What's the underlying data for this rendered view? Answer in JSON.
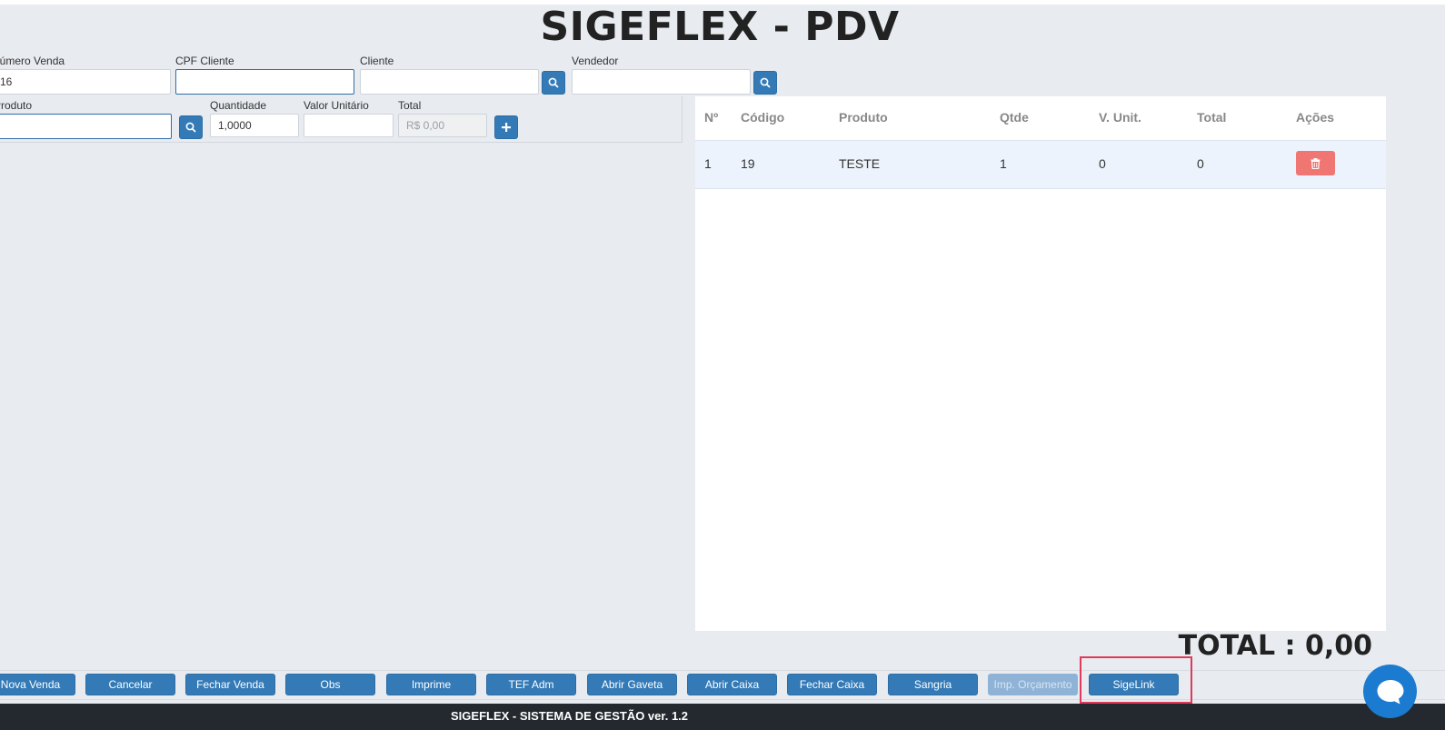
{
  "page_title": "SIGEFLEX - PDV",
  "form": {
    "numero_venda": {
      "label": "Número Venda",
      "value": "16"
    },
    "cpf_cliente": {
      "label": "CPF Cliente",
      "value": ""
    },
    "cliente": {
      "label": "Cliente",
      "value": ""
    },
    "vendedor": {
      "label": "Vendedor",
      "value": ""
    },
    "produto": {
      "label": "Produto",
      "value": ""
    },
    "quantidade": {
      "label": "Quantidade",
      "value": "1,0000"
    },
    "valor_unitario": {
      "label": "Valor Unitário",
      "value": ""
    },
    "total": {
      "label": "Total",
      "placeholder": "R$ 0,00"
    }
  },
  "table": {
    "headers": [
      "Nº",
      "Código",
      "Produto",
      "Qtde",
      "V. Unit.",
      "Total",
      "Ações"
    ],
    "rows": [
      {
        "n": "1",
        "codigo": "19",
        "produto": "TESTE",
        "qtde": "1",
        "v_unit": "0",
        "total": "0"
      }
    ]
  },
  "summary": {
    "total_text": "TOTAL : 0,00"
  },
  "actions": [
    "Nova Venda",
    "Cancelar",
    "Fechar Venda",
    "Obs",
    "Imprime",
    "TEF Adm",
    "Abrir Gaveta",
    "Abrir Caixa",
    "Fechar Caixa",
    "Sangria",
    "Imp. Orçamento",
    "SigeLink"
  ],
  "footer": {
    "text": "SIGEFLEX - SISTEMA DE GESTÃO ver. 1.2"
  },
  "colors": {
    "primary": "#337ab7",
    "danger": "#f07673",
    "footer_bg": "#23292e",
    "highlight": "#e03a5a",
    "chat": "#1b7bd0"
  },
  "icons": {
    "search": "search-icon",
    "add": "plus-icon",
    "delete": "trash-icon",
    "chat": "chat-icon"
  }
}
